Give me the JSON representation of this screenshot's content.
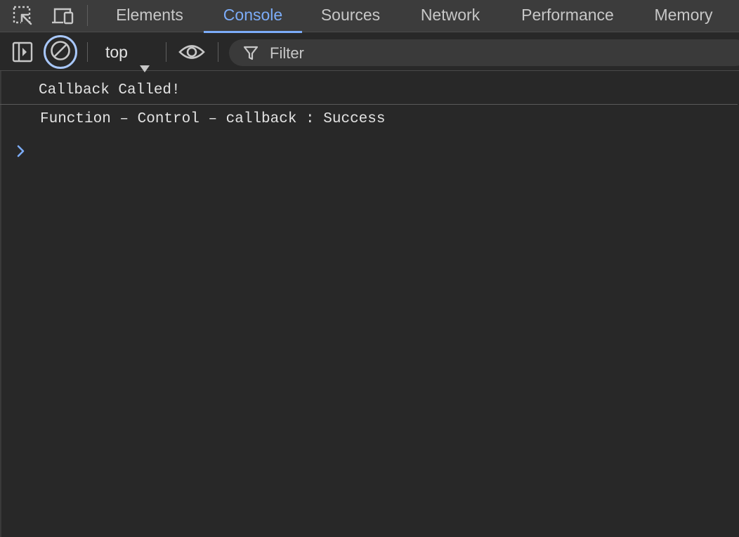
{
  "devtools": {
    "toolbar_icons": [
      "inspect-element-icon",
      "device-toolbar-icon"
    ],
    "tabs": [
      {
        "label": "Elements",
        "active": false
      },
      {
        "label": "Console",
        "active": true
      },
      {
        "label": "Sources",
        "active": false
      },
      {
        "label": "Network",
        "active": false
      },
      {
        "label": "Performance",
        "active": false
      },
      {
        "label": "Memory",
        "active": false
      }
    ],
    "accent_color": "#7cacf8"
  },
  "console_toolbar": {
    "icons": [
      "sidebar-toggle-icon",
      "clear-console-icon",
      "eye-icon",
      "filter-icon"
    ],
    "context": "top",
    "filter_placeholder": "Filter"
  },
  "console": {
    "messages": [
      "Callback Called!",
      "Function – Control – callback : Success"
    ],
    "prompt_symbol": "›"
  }
}
